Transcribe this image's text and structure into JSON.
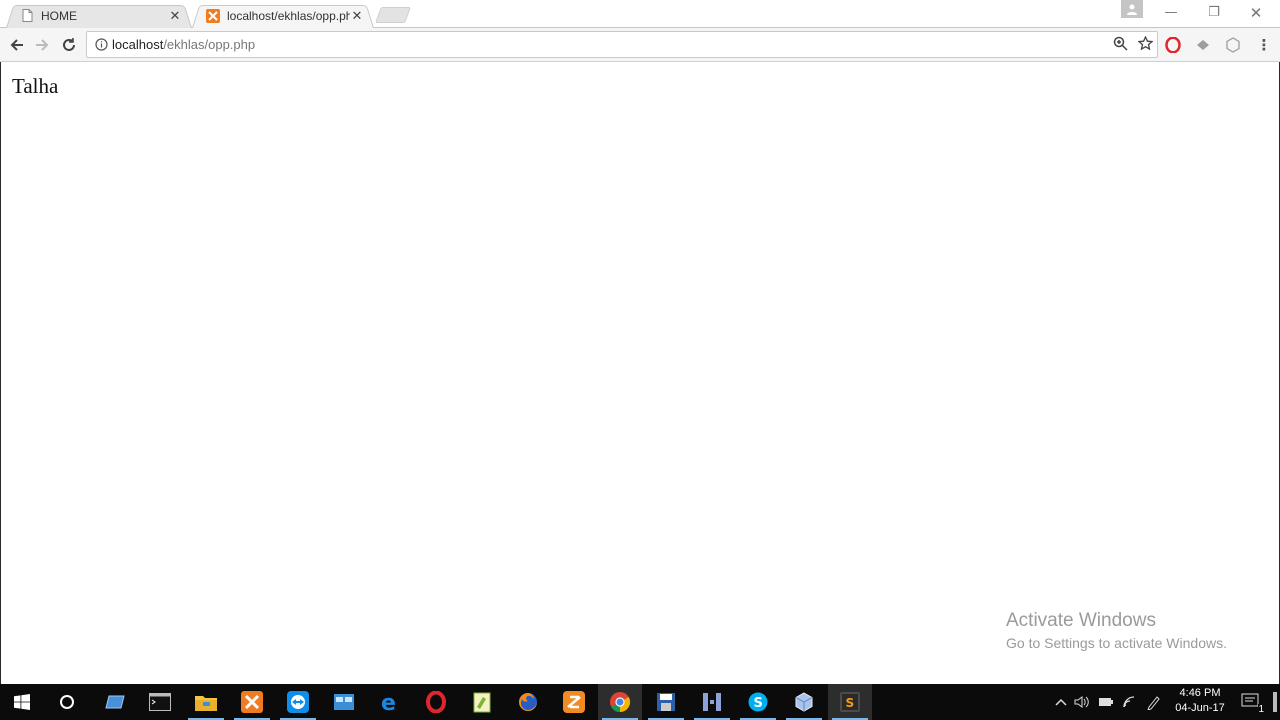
{
  "browser": {
    "tabs": [
      {
        "title": "HOME",
        "favicon": "page-icon",
        "active": false
      },
      {
        "title": "localhost/ekhlas/opp.php",
        "favicon": "xampp-icon",
        "active": true
      }
    ],
    "address_bar": {
      "host": "localhost",
      "path": "/ekhlas/opp.php"
    }
  },
  "page": {
    "text": "Talha"
  },
  "watermark": {
    "line1": "Activate Windows",
    "line2": "Go to Settings to activate Windows."
  },
  "taskbar": {
    "apps": [
      "start-icon",
      "cortana-icon",
      "tablet-icon",
      "cmd-icon",
      "file-explorer-icon",
      "xampp-icon",
      "teamviewer-icon",
      "app-icon",
      "edge-icon",
      "opera-icon",
      "notepad-plus-icon",
      "firefox-icon",
      "filezilla-icon",
      "chrome-icon",
      "file-save-icon",
      "h-app-icon",
      "skype-icon",
      "virtualbox-icon",
      "sublime-text-icon"
    ],
    "clock": {
      "time": "4:46 PM",
      "date": "04-Jun-17"
    },
    "notification_count": "1"
  },
  "colors": {
    "accent": "#76b9ed",
    "taskbar": "#0b0b0b",
    "toolbar": "#f5f5f5"
  }
}
